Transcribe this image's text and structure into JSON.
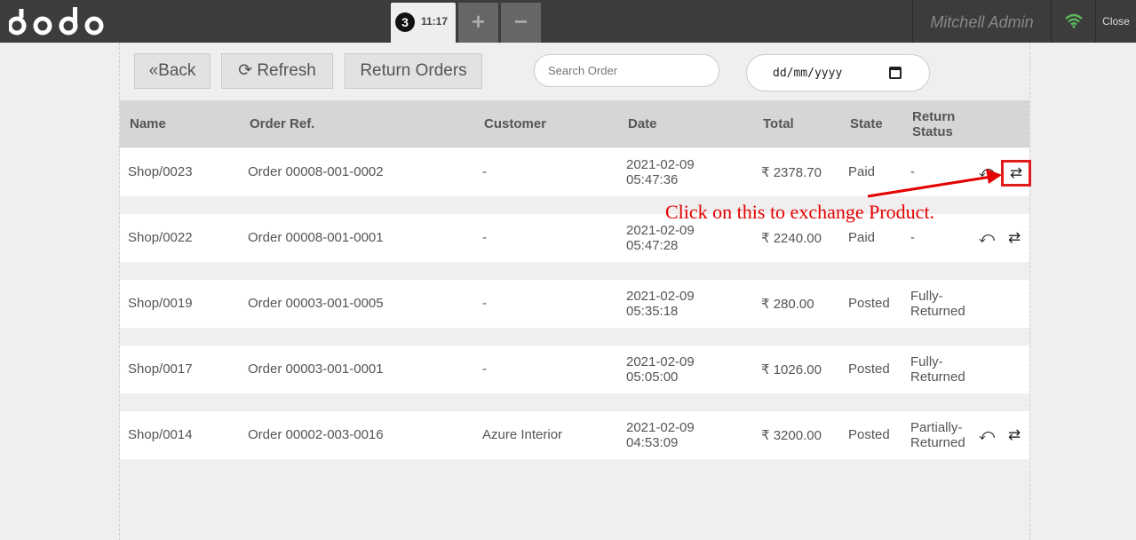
{
  "topbar": {
    "logo": "odoo",
    "order_tab": {
      "number": "3",
      "time": "11:17"
    },
    "add_tab": "+",
    "remove_tab": "−",
    "user_name": "Mitchell Admin",
    "close_label": "Close"
  },
  "controls": {
    "back_label": "Back",
    "back_icon": "«",
    "refresh_label": "Refresh",
    "refresh_icon": "⟳",
    "return_orders_label": "Return Orders",
    "search_placeholder": "Search Order",
    "date_placeholder": "dd/mm/yyyy"
  },
  "table": {
    "headers": [
      "Name",
      "Order Ref.",
      "Customer",
      "Date",
      "Total",
      "State",
      "Return",
      "Status"
    ],
    "rows": [
      {
        "name": "Shop/0023",
        "order_ref": "Order 00008-001-0002",
        "customer": "-",
        "date": "2021-02-09",
        "time": "05:47:36",
        "total": "₹ 2378.70",
        "state": "Paid",
        "return_status_1": "-",
        "return_status_2": "",
        "return_icon": "⤺",
        "exchange_icon": "⇄"
      },
      {
        "name": "Shop/0022",
        "order_ref": "Order 00008-001-0001",
        "customer": "-",
        "date": "2021-02-09",
        "time": "05:47:28",
        "total": "₹ 2240.00",
        "state": "Paid",
        "return_status_1": "-",
        "return_status_2": "",
        "return_icon": "⤺",
        "exchange_icon": "⇄"
      },
      {
        "name": "Shop/0019",
        "order_ref": "Order 00003-001-0005",
        "customer": "-",
        "date": "2021-02-09",
        "time": "05:35:18",
        "total": "₹ 280.00",
        "state": "Posted",
        "return_status_1": "Fully-",
        "return_status_2": "Returned"
      },
      {
        "name": "Shop/0017",
        "order_ref": "Order 00003-001-0001",
        "customer": "-",
        "date": "2021-02-09",
        "time": "05:05:00",
        "total": "₹ 1026.00",
        "state": "Posted",
        "return_status_1": "Fully-",
        "return_status_2": "Returned"
      },
      {
        "name": "Shop/0014",
        "order_ref": "Order 00002-003-0016",
        "customer": "Azure Interior",
        "date": "2021-02-09",
        "time": "04:53:09",
        "total": "₹ 3200.00",
        "state": "Posted",
        "return_status_1": "Partially-",
        "return_status_2": "Returned",
        "return_icon": "⤺",
        "exchange_icon": "⇄"
      }
    ]
  },
  "annotation": {
    "text": "Click on this to exchange Product.",
    "color": "#e40000"
  }
}
